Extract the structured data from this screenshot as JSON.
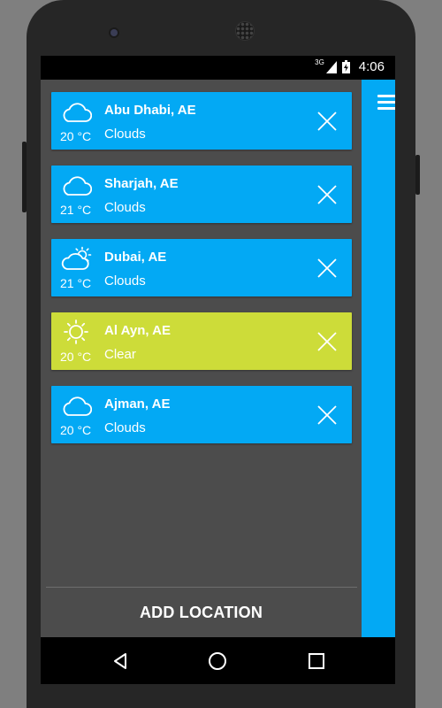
{
  "status_bar": {
    "network": "3G",
    "signal_icon": "signal-icon",
    "battery_icon": "battery-charging-icon",
    "time": "4:06"
  },
  "menu": {
    "icon": "hamburger-menu-icon"
  },
  "locations": [
    {
      "city": "Abu Dhabi, AE",
      "temperature": "20 °C",
      "condition": "Clouds",
      "icon": "cloud-icon",
      "color": "#03a9f4"
    },
    {
      "city": "Sharjah, AE",
      "temperature": "21 °C",
      "condition": "Clouds",
      "icon": "cloud-icon",
      "color": "#03a9f4"
    },
    {
      "city": "Dubai, AE",
      "temperature": "21 °C",
      "condition": "Clouds",
      "icon": "partly-cloudy-icon",
      "color": "#03a9f4"
    },
    {
      "city": "Al Ayn, AE",
      "temperature": "20 °C",
      "condition": "Clear",
      "icon": "sun-icon",
      "color": "#cddc39"
    },
    {
      "city": "Ajman, AE",
      "temperature": "20 °C",
      "condition": "Clouds",
      "icon": "cloud-icon",
      "color": "#03a9f4"
    }
  ],
  "add_location_label": "ADD LOCATION",
  "nav": {
    "back_icon": "back-icon",
    "home_icon": "home-icon",
    "recents_icon": "recents-icon"
  },
  "colors": {
    "accent_blue": "#03a9f4",
    "clear_green": "#cddc39",
    "screen_bg": "#4c4c4c"
  }
}
